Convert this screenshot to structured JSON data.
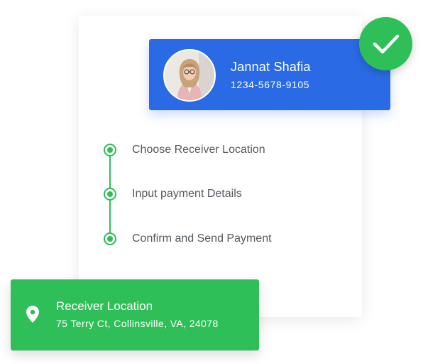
{
  "profile": {
    "name": "Jannat Shafia",
    "phone": "1234-5678-9105",
    "avatar_icon": "user-avatar-photo"
  },
  "status": {
    "icon": "check-icon",
    "color": "#2fbf58"
  },
  "steps": [
    {
      "label": "Choose Receiver Location"
    },
    {
      "label": "Input payment Details"
    },
    {
      "label": "Confirm and Send Payment"
    }
  ],
  "location": {
    "title": "Receiver Location",
    "address": "75 Terry Ct, Collinsville, VA, 24078",
    "icon": "map-pin-icon"
  },
  "colors": {
    "primary_blue": "#2a6ae4",
    "accent_green": "#2fbf58",
    "step_text": "#555a5f"
  }
}
